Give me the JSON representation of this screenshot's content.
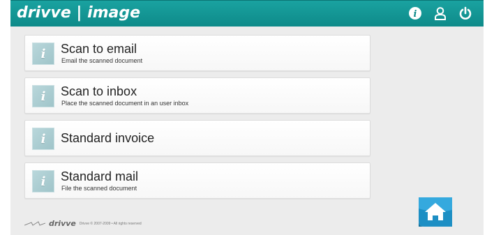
{
  "app": {
    "brand": "drivve | image",
    "accent_color": "#1aa3a1"
  },
  "header": {
    "icons": [
      {
        "name": "info-icon",
        "label": "Info"
      },
      {
        "name": "user-icon",
        "label": "User"
      },
      {
        "name": "power-icon",
        "label": "Log out"
      }
    ]
  },
  "workflows": [
    {
      "title": "Scan to email",
      "subtitle": "Email the scanned document"
    },
    {
      "title": "Scan to inbox",
      "subtitle": "Place the scanned document in an user inbox"
    },
    {
      "title": "Standard invoice",
      "subtitle": ""
    },
    {
      "title": "Standard mail",
      "subtitle": "File the scanned document"
    }
  ],
  "info_glyph": "i",
  "footer": {
    "logo": "drivve",
    "copyright": "Drivve © 2007-2009 • All rights reserved"
  },
  "home": {
    "icon": "home-icon"
  }
}
